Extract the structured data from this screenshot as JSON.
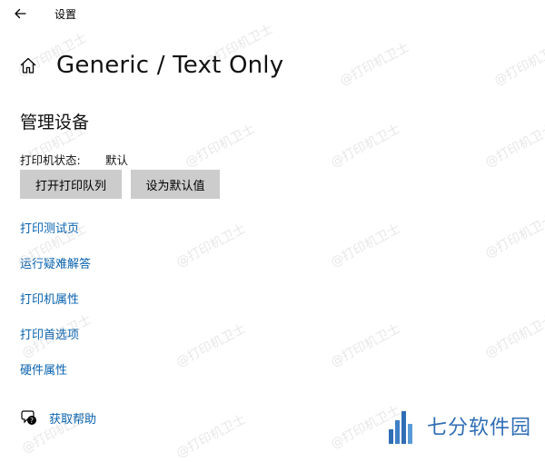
{
  "window": {
    "title": "设置"
  },
  "header": {
    "title": "Generic / Text Only"
  },
  "section": {
    "title": "管理设备"
  },
  "status": {
    "label": "打印机状态:",
    "value": "默认"
  },
  "buttons": {
    "open_queue": "打开打印队列",
    "set_default": "设为默认值"
  },
  "links": [
    {
      "label": "打印测试页"
    },
    {
      "label": "运行疑难解答"
    },
    {
      "label": "打印机属性"
    },
    {
      "label": "打印首选项"
    },
    {
      "label": "硬件属性"
    }
  ],
  "help": {
    "label": "获取帮助"
  },
  "watermark": {
    "text": "@打印机卫士"
  },
  "site_badge": {
    "text": "七分软件园"
  },
  "colors": {
    "link": "#0a63b0",
    "button_bg": "#cccccc",
    "badge": "#2f6db5"
  }
}
